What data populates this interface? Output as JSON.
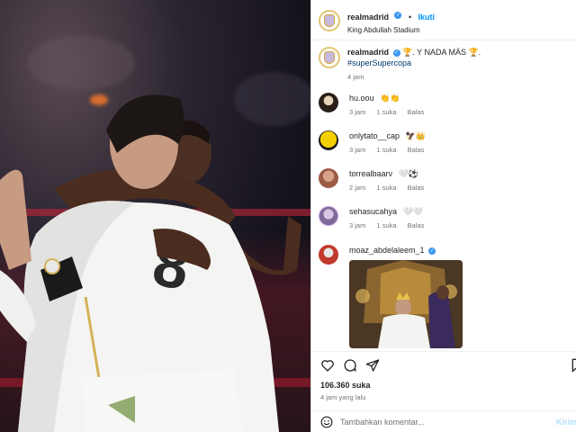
{
  "post": {
    "header": {
      "username": "realmadrid",
      "verified_mark": "✓",
      "separator": "•",
      "follow_label": "Ikuti",
      "location": "King Abdullah Stadium"
    },
    "caption": {
      "username": "realmadrid",
      "text": "🏆. Y NADA MÁS 🏆.",
      "hashtag": "#superSupercopa",
      "time": "4 jam"
    },
    "comments": [
      {
        "username": "hu.oou",
        "text": "👏👏",
        "time": "3 jam",
        "likes": "1 suka",
        "reply": "Balas"
      },
      {
        "username": "onlytato__cap",
        "text": "🦅👑",
        "time": "3 jam",
        "likes": "1 suka",
        "reply": "Balas"
      },
      {
        "username": "torrealbaarv",
        "text": "🤍⚽",
        "time": "2 jam",
        "likes": "1 suka",
        "reply": "Balas"
      },
      {
        "username": "sehasucahya",
        "text": "🤍🤍",
        "time": "3 jam",
        "likes": "1 suka",
        "reply": "Balas"
      },
      {
        "username": "moaz_abdelaleem_1",
        "verified_mark": "✓"
      }
    ],
    "likes_count": "106.360 suka",
    "posted_ago": "4 jam yang lalu",
    "add_comment": {
      "placeholder": "Tambahkan komentar...",
      "send_label": "Kirim"
    },
    "icons": [
      "heart-icon",
      "comment-icon",
      "share-icon",
      "bookmark-icon",
      "emoji-icon"
    ]
  },
  "colors": {
    "link_blue": "#0095f6",
    "verified_blue": "#3897f0",
    "muted_text": "#737373",
    "hashtag": "#00376b",
    "kit_white": "#ffffff",
    "kit_gold": "#d4b25a"
  }
}
